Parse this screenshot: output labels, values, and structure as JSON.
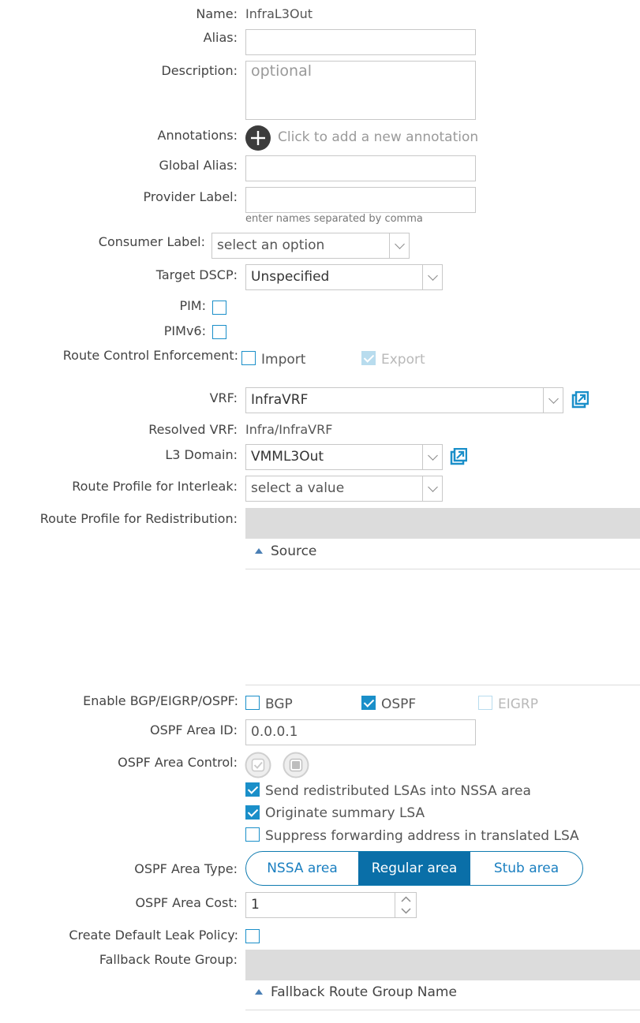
{
  "name": {
    "label": "Name:",
    "value": "InfraL3Out"
  },
  "alias": {
    "label": "Alias:",
    "value": ""
  },
  "description": {
    "label": "Description:",
    "placeholder": "optional"
  },
  "annotations": {
    "label": "Annotations:",
    "add_text": "Click to add a new annotation"
  },
  "global_alias": {
    "label": "Global Alias:",
    "value": ""
  },
  "provider_label": {
    "label": "Provider Label:",
    "value": "",
    "hint": "enter names separated by comma"
  },
  "consumer_label": {
    "label": "Consumer Label:",
    "value": "select an option"
  },
  "target_dscp": {
    "label": "Target DSCP:",
    "value": "Unspecified"
  },
  "pim": {
    "label": "PIM:",
    "checked": false
  },
  "pimv6": {
    "label": "PIMv6:",
    "checked": false
  },
  "route_control": {
    "label": "Route Control Enforcement:",
    "import_label": "Import",
    "import_checked": false,
    "export_label": "Export",
    "export_checked": true
  },
  "vrf": {
    "label": "VRF:",
    "value": "InfraVRF"
  },
  "resolved_vrf": {
    "label": "Resolved VRF:",
    "value": "Infra/InfraVRF"
  },
  "l3_domain": {
    "label": "L3 Domain:",
    "value": "VMML3Out"
  },
  "route_profile_interleak": {
    "label": "Route Profile for Interleak:",
    "value": "select a value"
  },
  "route_profile_redistribution": {
    "label": "Route Profile for Redistribution:",
    "column": "Source"
  },
  "enable_protocols": {
    "label": "Enable BGP/EIGRP/OSPF:",
    "bgp": "BGP",
    "bgp_checked": false,
    "ospf": "OSPF",
    "ospf_checked": true,
    "eigrp": "EIGRP",
    "eigrp_checked": false
  },
  "ospf_area_id": {
    "label": "OSPF Area ID:",
    "value": "0.0.0.1"
  },
  "ospf_area_control": {
    "label": "OSPF Area Control:",
    "options": [
      {
        "label": "Send redistributed LSAs into NSSA area",
        "checked": true
      },
      {
        "label": "Originate summary LSA",
        "checked": true
      },
      {
        "label": "Suppress forwarding address in translated LSA",
        "checked": false
      }
    ]
  },
  "ospf_area_type": {
    "label": "OSPF Area Type:",
    "options": [
      "NSSA area",
      "Regular area",
      "Stub area"
    ],
    "selected": "Regular area"
  },
  "ospf_area_cost": {
    "label": "OSPF Area Cost:",
    "value": "1"
  },
  "default_leak": {
    "label": "Create Default Leak Policy:",
    "checked": false
  },
  "fallback_route_group": {
    "label": "Fallback Route Group:",
    "column": "Fallback Route Group Name"
  },
  "colors": {
    "accent": "#1a8fc9",
    "active_segment": "#0a6fa8"
  }
}
